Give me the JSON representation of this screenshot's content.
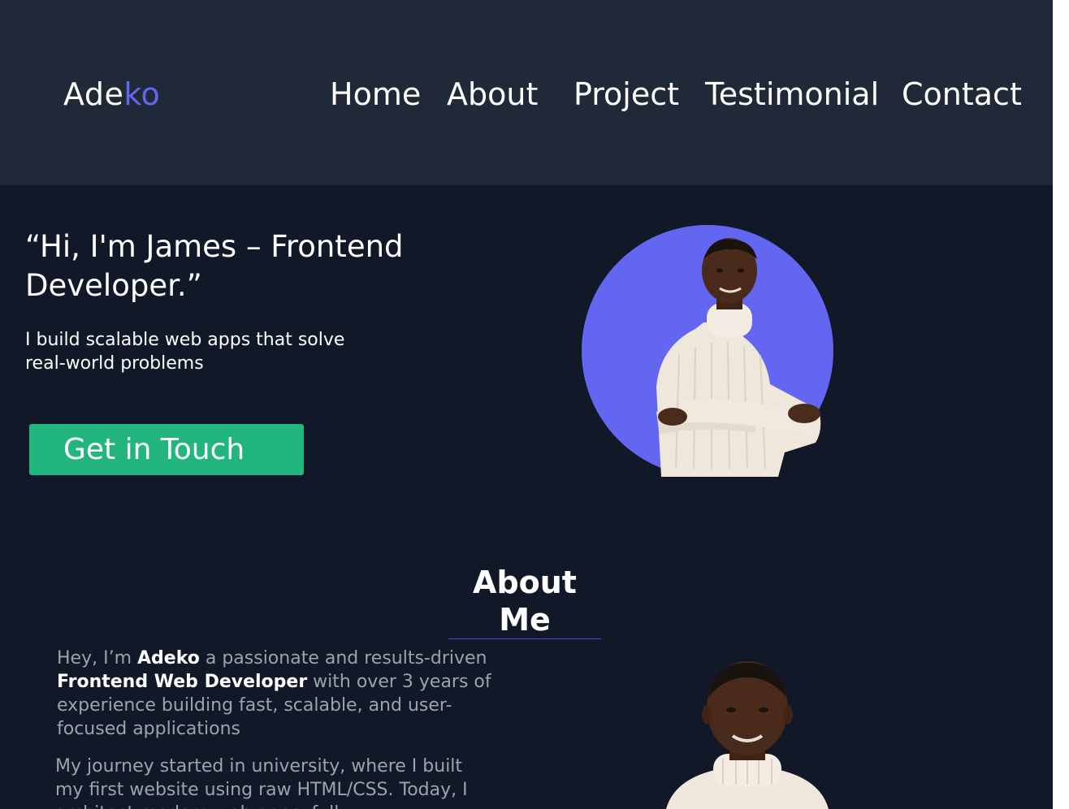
{
  "header": {
    "logo": {
      "prefix": "Ade",
      "accent": "ko"
    },
    "nav": [
      {
        "label": "Home"
      },
      {
        "label": "About"
      },
      {
        "label": "Project"
      },
      {
        "label": "Testimonial"
      },
      {
        "label": "Contact"
      }
    ]
  },
  "hero": {
    "title": "“Hi, I'm James – Frontend Developer.”",
    "subtitle": "I build scalable web apps that solve real-world problems",
    "cta_label": "Get in Touch"
  },
  "about": {
    "title": "About Me",
    "p1": {
      "t1": "Hey, I’m ",
      "b1": "Adeko",
      "t2": "  a passionate and results-driven ",
      "b2": "Frontend Web Developer",
      "t3": " with over 3 years of experience building fast, scalable, and user-focused applications"
    },
    "p2": " My journey started in university, where I built my first website using raw HTML/CSS. Today, I architect modern web apps, full"
  },
  "colors": {
    "header_bg": "#1f2937",
    "page_bg": "#111827",
    "accent": "#6366f1",
    "cta_bg": "#22b57e",
    "muted_text": "#9ca3af"
  }
}
